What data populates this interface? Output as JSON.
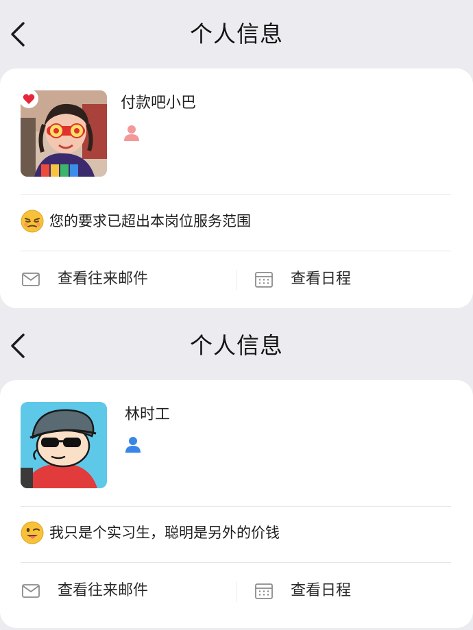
{
  "profiles": [
    {
      "nav_title": "个人信息",
      "name": "付款吧小巴",
      "gender": "female",
      "gender_color": "#f29a9a",
      "status_emoji": "sleepy-face",
      "status": "您的要求已超出本岗位服务范围",
      "actions": {
        "mail_label": "查看往来邮件",
        "calendar_label": "查看日程"
      }
    },
    {
      "nav_title": "个人信息",
      "name": "林时工",
      "gender": "male",
      "gender_color": "#3a86e8",
      "status_emoji": "winking-tongue-face",
      "status": "我只是个实习生，聪明是另外的价钱",
      "actions": {
        "mail_label": "查看往来邮件",
        "calendar_label": "查看日程"
      }
    }
  ],
  "icons": {
    "back": "chevron-left-icon",
    "mail": "mail-icon",
    "calendar": "calendar-icon",
    "gender": "person-icon"
  },
  "colors": {
    "page_background": "#ececf0",
    "card_background": "#ffffff"
  }
}
